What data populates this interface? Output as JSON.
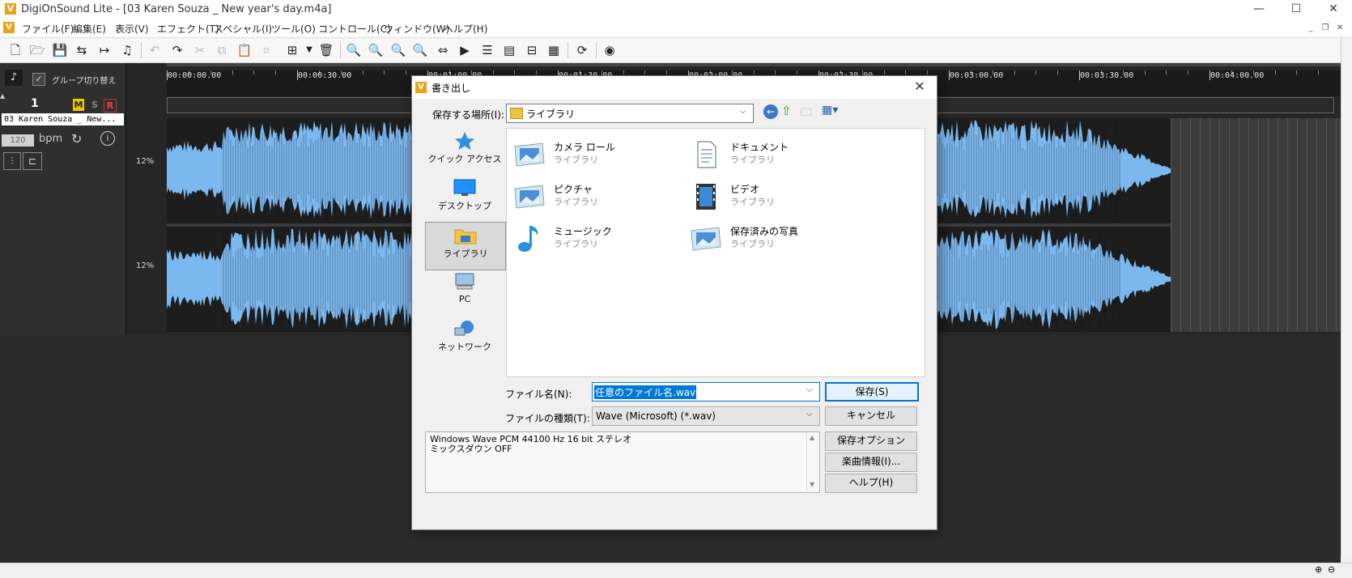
{
  "window": {
    "title": "DigiOnSound Lite - [03 Karen Souza _ New year's day.m4a]",
    "logo": "V"
  },
  "menu": [
    "ファイル(F)",
    "編集(E)",
    "表示(V)",
    "エフェクト(T)",
    "スペシャル(I)",
    "ツール(O)",
    "コントロール(C)",
    "ウィンドウ(W)",
    "ヘルプ(H)"
  ],
  "track": {
    "group_label": "グループ切り替え",
    "number": "1",
    "m": "M",
    "s": "S",
    "r": "R",
    "name": "03 Karen Souza _ New...",
    "bpm_value": "120",
    "bpm_label": "bpm",
    "level_top": "12%",
    "level_bottom": "12%"
  },
  "ruler": [
    "00:00:00.00",
    "00:00:30.00",
    "00:01:00.00",
    "00:01:30.00",
    "00:02:00.00",
    "00:02:30.00",
    "00:03:00.00",
    "00:03:30.00",
    "00:04:00.00"
  ],
  "dialog": {
    "title": "書き出し",
    "location_label": "保存する場所(I):",
    "location_value": "ライブラリ",
    "nav": [
      {
        "label": "クイック アクセス",
        "icon": "star-icon"
      },
      {
        "label": "デスクトップ",
        "icon": "desktop-icon"
      },
      {
        "label": "ライブラリ",
        "icon": "library-icon"
      },
      {
        "label": "PC",
        "icon": "pc-icon"
      },
      {
        "label": "ネットワーク",
        "icon": "network-icon"
      }
    ],
    "items": [
      {
        "name": "カメラ ロール",
        "sub": "ライブラリ",
        "icon": "picture-folder-icon"
      },
      {
        "name": "ドキュメント",
        "sub": "ライブラリ",
        "icon": "document-icon"
      },
      {
        "name": "ピクチャ",
        "sub": "ライブラリ",
        "icon": "picture-folder-icon"
      },
      {
        "name": "ビデオ",
        "sub": "ライブラリ",
        "icon": "video-icon"
      },
      {
        "name": "ミュージック",
        "sub": "ライブラリ",
        "icon": "music-icon"
      },
      {
        "name": "保存済みの写真",
        "sub": "ライブラリ",
        "icon": "picture-folder-icon"
      }
    ],
    "filename_label": "ファイル名(N):",
    "filename_value": "任意のファイル名.wav",
    "filetype_label": "ファイルの種類(T):",
    "filetype_value": "Wave (Microsoft) (*.wav)",
    "info_line1": "Windows Wave PCM 44100 Hz 16 bit ステレオ",
    "info_line2": "ミックスダウン OFF",
    "save_button": "保存(S)",
    "cancel_button": "キャンセル",
    "options_button": "保存オプション(D)...",
    "song_info_button": "楽曲情報(I)...",
    "help_button": "ヘルプ(H)"
  },
  "colors": {
    "waveform": "#7cb8f0",
    "accent": "#e8a317",
    "select_highlight": "#0078d7"
  }
}
